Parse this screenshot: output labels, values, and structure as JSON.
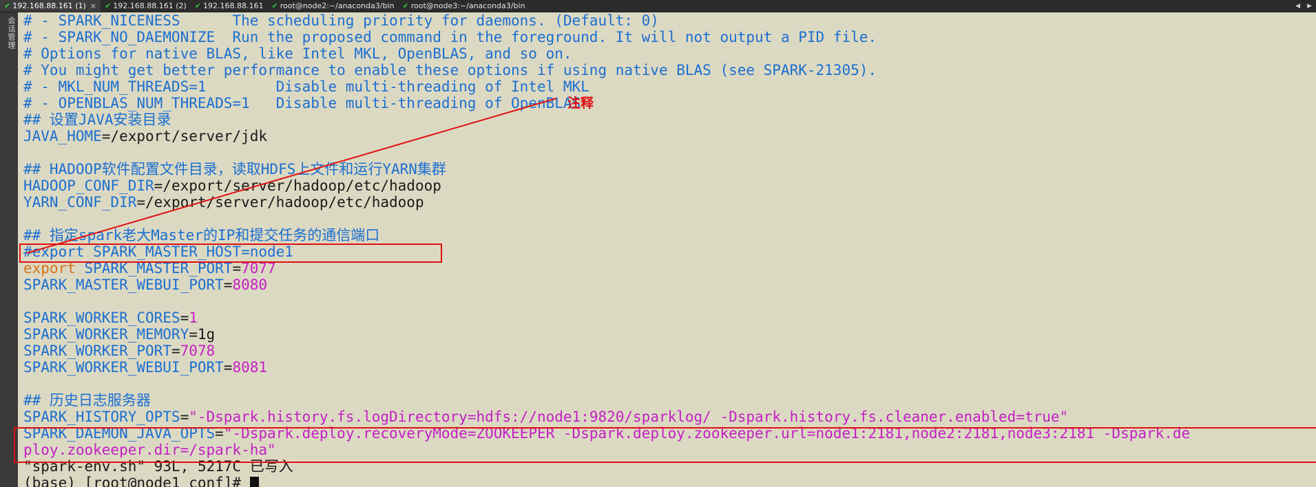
{
  "tabs": [
    {
      "label": "192.168.88.161 (1)",
      "active": true
    },
    {
      "label": "192.168.88.161 (2)",
      "active": false
    },
    {
      "label": "192.168.88.161",
      "active": false
    },
    {
      "label": "root@node2:~/anaconda3/bin",
      "active": false
    },
    {
      "label": "root@node3:~/anaconda3/bin",
      "active": false
    }
  ],
  "sidebar": {
    "label": "会话管理"
  },
  "annotation": {
    "label": "注释",
    "color": "#e01010"
  },
  "colors": {
    "background": "#dcd9c3",
    "comment": "#1b6fd0",
    "keyword": "#d6731a",
    "value": "#c420c4"
  },
  "terminal": {
    "l1": "# - SPARK_NICENESS      The scheduling priority for daemons. (Default: 0)",
    "l2": "# - SPARK_NO_DAEMONIZE  Run the proposed command in the foreground. It will not output a PID file.",
    "l3": "# Options for native BLAS, like Intel MKL, OpenBLAS, and so on.",
    "l4": "# You might get better performance to enable these options if using native BLAS (see SPARK-21305).",
    "l5": "# - MKL_NUM_THREADS=1        Disable multi-threading of Intel MKL",
    "l6": "# - OPENBLAS_NUM_THREADS=1   Disable multi-threading of OpenBLAS",
    "l7": "## 设置JAVA安装目录",
    "l8_var": "JAVA_HOME",
    "l8_val": "=/export/server/jdk",
    "l10": "## HADOOP软件配置文件目录，读取HDFS上文件和运行YARN集群",
    "l11_var": "HADOOP_CONF_DIR",
    "l11_val": "=/export/server/hadoop/etc/hadoop",
    "l12_var": "YARN_CONF_DIR",
    "l12_val": "=/export/server/hadoop/etc/hadoop",
    "l14": "## 指定spark老大Master的IP和提交任务的通信端口",
    "l15": "#export SPARK_MASTER_HOST=node1",
    "l16_kw": "export",
    "l16_var": " SPARK_MASTER_PORT",
    "l16_eq": "=",
    "l16_num": "7077",
    "l17_var": "SPARK_MASTER_WEBUI_PORT",
    "l17_eq": "=",
    "l17_num": "8080",
    "l19_var": "SPARK_WORKER_CORES",
    "l19_eq": "=",
    "l19_num": "1",
    "l20_var": "SPARK_WORKER_MEMORY",
    "l20_val": "=1g",
    "l21_var": "SPARK_WORKER_PORT",
    "l21_eq": "=",
    "l21_num": "7078",
    "l22_var": "SPARK_WORKER_WEBUI_PORT",
    "l22_eq": "=",
    "l22_num": "8081",
    "l24": "## 历史日志服务器",
    "l25_var": "SPARK_HISTORY_OPTS",
    "l25_eq": "=",
    "l25_str": "\"-Dspark.history.fs.logDirectory=hdfs://node1:9820/sparklog/ -Dspark.history.fs.cleaner.enabled=true\"",
    "l26_var": "SPARK_DAEMON_JAVA_OPTS",
    "l26_eq": "=",
    "l26_str": "\"-Dspark.deploy.recoveryMode=ZOOKEEPER -Dspark.deploy.zookeeper.url=node1:2181,node2:2181,node3:2181 -Dspark.de",
    "l27_str": "ploy.zookeeper.dir=/spark-ha\"",
    "l28": "\"spark-env.sh\" 93L, 5217C 已写入",
    "l29": "(base) [root@node1 conf]# "
  }
}
